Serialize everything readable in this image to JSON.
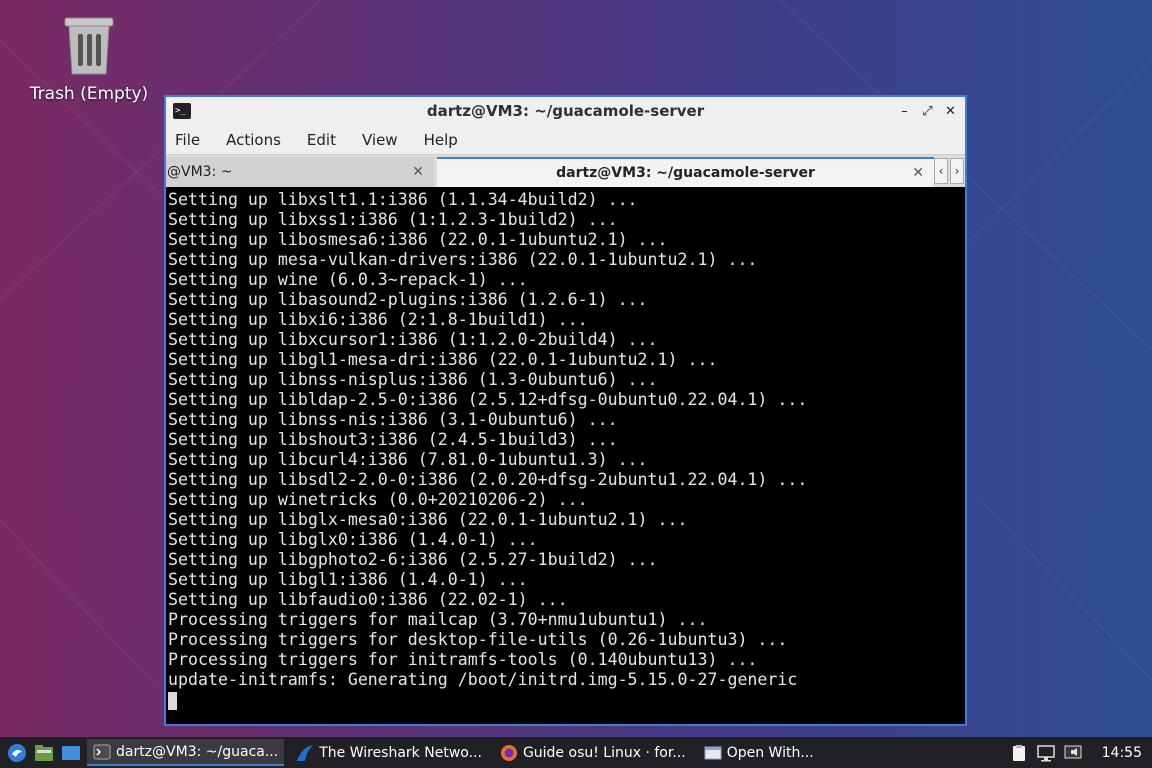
{
  "desktop": {
    "trash": {
      "label": "Trash (Empty)",
      "icon": "trash-icon"
    }
  },
  "window": {
    "title": "dartz@VM3: ~/guacamole-server",
    "menu": [
      "File",
      "Actions",
      "Edit",
      "View",
      "Help"
    ],
    "tabs": [
      {
        "label": "@VM3: ~",
        "active": false
      },
      {
        "label": "dartz@VM3: ~/guacamole-server",
        "active": true
      }
    ],
    "controls": {
      "minimize": "–",
      "maximize": "⤢",
      "close": "✕"
    }
  },
  "terminal": {
    "lines": [
      "Setting up libxslt1.1:i386 (1.1.34-4build2) ...",
      "Setting up libxss1:i386 (1:1.2.3-1build2) ...",
      "Setting up libosmesa6:i386 (22.0.1-1ubuntu2.1) ...",
      "Setting up mesa-vulkan-drivers:i386 (22.0.1-1ubuntu2.1) ...",
      "Setting up wine (6.0.3~repack-1) ...",
      "Setting up libasound2-plugins:i386 (1.2.6-1) ...",
      "Setting up libxi6:i386 (2:1.8-1build1) ...",
      "Setting up libxcursor1:i386 (1:1.2.0-2build4) ...",
      "Setting up libgl1-mesa-dri:i386 (22.0.1-1ubuntu2.1) ...",
      "Setting up libnss-nisplus:i386 (1.3-0ubuntu6) ...",
      "Setting up libldap-2.5-0:i386 (2.5.12+dfsg-0ubuntu0.22.04.1) ...",
      "Setting up libnss-nis:i386 (3.1-0ubuntu6) ...",
      "Setting up libshout3:i386 (2.4.5-1build3) ...",
      "Setting up libcurl4:i386 (7.81.0-1ubuntu1.3) ...",
      "Setting up libsdl2-2.0-0:i386 (2.0.20+dfsg-2ubuntu1.22.04.1) ...",
      "Setting up winetricks (0.0+20210206-2) ...",
      "Setting up libglx-mesa0:i386 (22.0.1-1ubuntu2.1) ...",
      "Setting up libglx0:i386 (1.4.0-1) ...",
      "Setting up libgphoto2-6:i386 (2.5.27-1build2) ...",
      "Setting up libgl1:i386 (1.4.0-1) ...",
      "Setting up libfaudio0:i386 (22.02-1) ...",
      "Processing triggers for mailcap (3.70+nmu1ubuntu1) ...",
      "Processing triggers for desktop-file-utils (0.26-1ubuntu3) ...",
      "Processing triggers for initramfs-tools (0.140ubuntu13) ...",
      "update-initramfs: Generating /boot/initrd.img-5.15.0-27-generic"
    ]
  },
  "taskbar": {
    "tasks": [
      {
        "label": "dartz@VM3: ~/guaca...",
        "icon": "terminal-icon",
        "active": true
      },
      {
        "label": "The Wireshark Netwo...",
        "icon": "wireshark-icon",
        "active": false
      },
      {
        "label": "Guide osu! Linux · for...",
        "icon": "firefox-icon",
        "active": false
      },
      {
        "label": "Open With...",
        "icon": "window-icon",
        "active": false
      }
    ],
    "clock": "14:55"
  },
  "colors": {
    "accent": "#3b7fd6",
    "terminal_bg": "#000000",
    "terminal_fg": "#e6e6e6",
    "taskbar_bg": "#202124"
  }
}
